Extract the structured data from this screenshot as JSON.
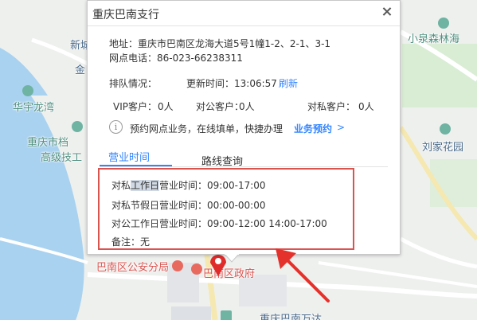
{
  "popup": {
    "title": "重庆巴南支行",
    "address_line": "地址：重庆市巴南区龙海大道5号1幢1-2、2-1、3-1",
    "phone_line": "网点电话：86-023-66238311",
    "queue_label": "排队情况：",
    "update_time_label": "更新时间：13:06:57",
    "refresh_link": "刷新",
    "vip_label": "VIP客户：",
    "vip_count": "0人",
    "corporate_label": "对公客户：",
    "corporate_count": "0人",
    "personal_label": "对私客户：",
    "personal_count": "0人",
    "booking_hint": "预约网点业务，在线填单，快捷办理",
    "booking_link": "业务预约",
    "booking_chevron": ">",
    "tabs": [
      "营业时间",
      "路线查询"
    ],
    "hours": {
      "row1_prefix": "对私",
      "row1_highlight": "工作日",
      "row1_suffix": "营业时间：09:00-17:00",
      "row2": "对私节假日营业时间：00:00-00:00",
      "row3": "对公工作日营业时间：09:00-12:00  14:00-17:00",
      "note": "备注：无"
    }
  },
  "map_labels": {
    "xincheng_partial": "新城",
    "jin_partial": "金",
    "huayu": "华宇龙湾",
    "chongqing_city": "重庆市档",
    "gaoji": "高级技工",
    "xiaoquan": "小泉森林海",
    "liujia": "刘家花园",
    "police": "巴南区公安分局",
    "government": "巴南区政府",
    "bottom_partial": "重庆巴南万达"
  },
  "colors": {
    "accent": "#3385ff",
    "highlight_box": "#d9534f",
    "river": "#a9d2f0"
  },
  "icons": {
    "close": "close-icon",
    "info": "info-icon",
    "marker": "map-marker-icon"
  }
}
